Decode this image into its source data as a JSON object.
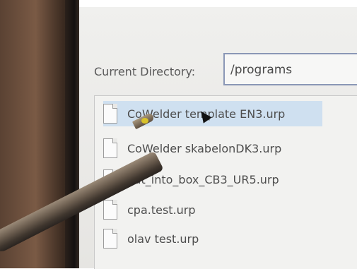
{
  "directory": {
    "label": "Current Directory:",
    "value": "/programs"
  },
  "files": [
    {
      "name": "CoWelder template EN3.urp",
      "selected": true
    },
    {
      "name": "CoWelder skabelonDK3.urp",
      "selected": false
    },
    {
      "name": "Put_into_box_CB3_UR5.urp",
      "selected": false
    },
    {
      "name": "cpa.test.urp",
      "selected": false
    },
    {
      "name": "olav test.urp",
      "selected": false
    }
  ],
  "icons": {
    "file": "file-icon",
    "pointer": "mouse-cursor-icon"
  },
  "colors": {
    "selection": "#cfe0f0",
    "field_border": "#8a97b6"
  }
}
